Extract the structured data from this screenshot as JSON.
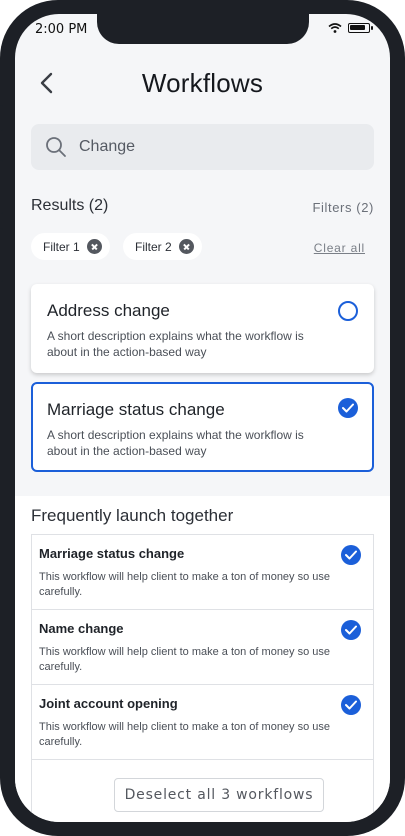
{
  "status_bar": {
    "time": "2:00 PM"
  },
  "header": {
    "title": "Workflows"
  },
  "search": {
    "value": "Change"
  },
  "results": {
    "title": "Results (2)",
    "filters_link": "Filters (2)"
  },
  "chips": [
    {
      "label": "Filter 1"
    },
    {
      "label": "Filter 2"
    }
  ],
  "clear_all": "Clear all",
  "result_cards": [
    {
      "title": "Address change",
      "description": "A short description explains what the workflow is about in the action-based way",
      "selected": false
    },
    {
      "title": "Marriage status change",
      "description": "A short description explains what the workflow is about in the action-based way",
      "selected": true
    }
  ],
  "together": {
    "title": "Frequently launch together",
    "items": [
      {
        "title": "Marriage status change",
        "description": "This workflow will help client to make a ton of money so use carefully.",
        "checked": true
      },
      {
        "title": "Name change",
        "description": "This workflow will help client to make a ton of money so use carefully.",
        "checked": true
      },
      {
        "title": "Joint account opening",
        "description": "This workflow will help client to make a ton of money so use carefully.",
        "checked": true
      }
    ],
    "deselect_label": "Deselect all 3 workflows"
  },
  "colors": {
    "accent": "#1b5fd9",
    "frame": "#1d2026",
    "background": "#f5f6f8"
  }
}
